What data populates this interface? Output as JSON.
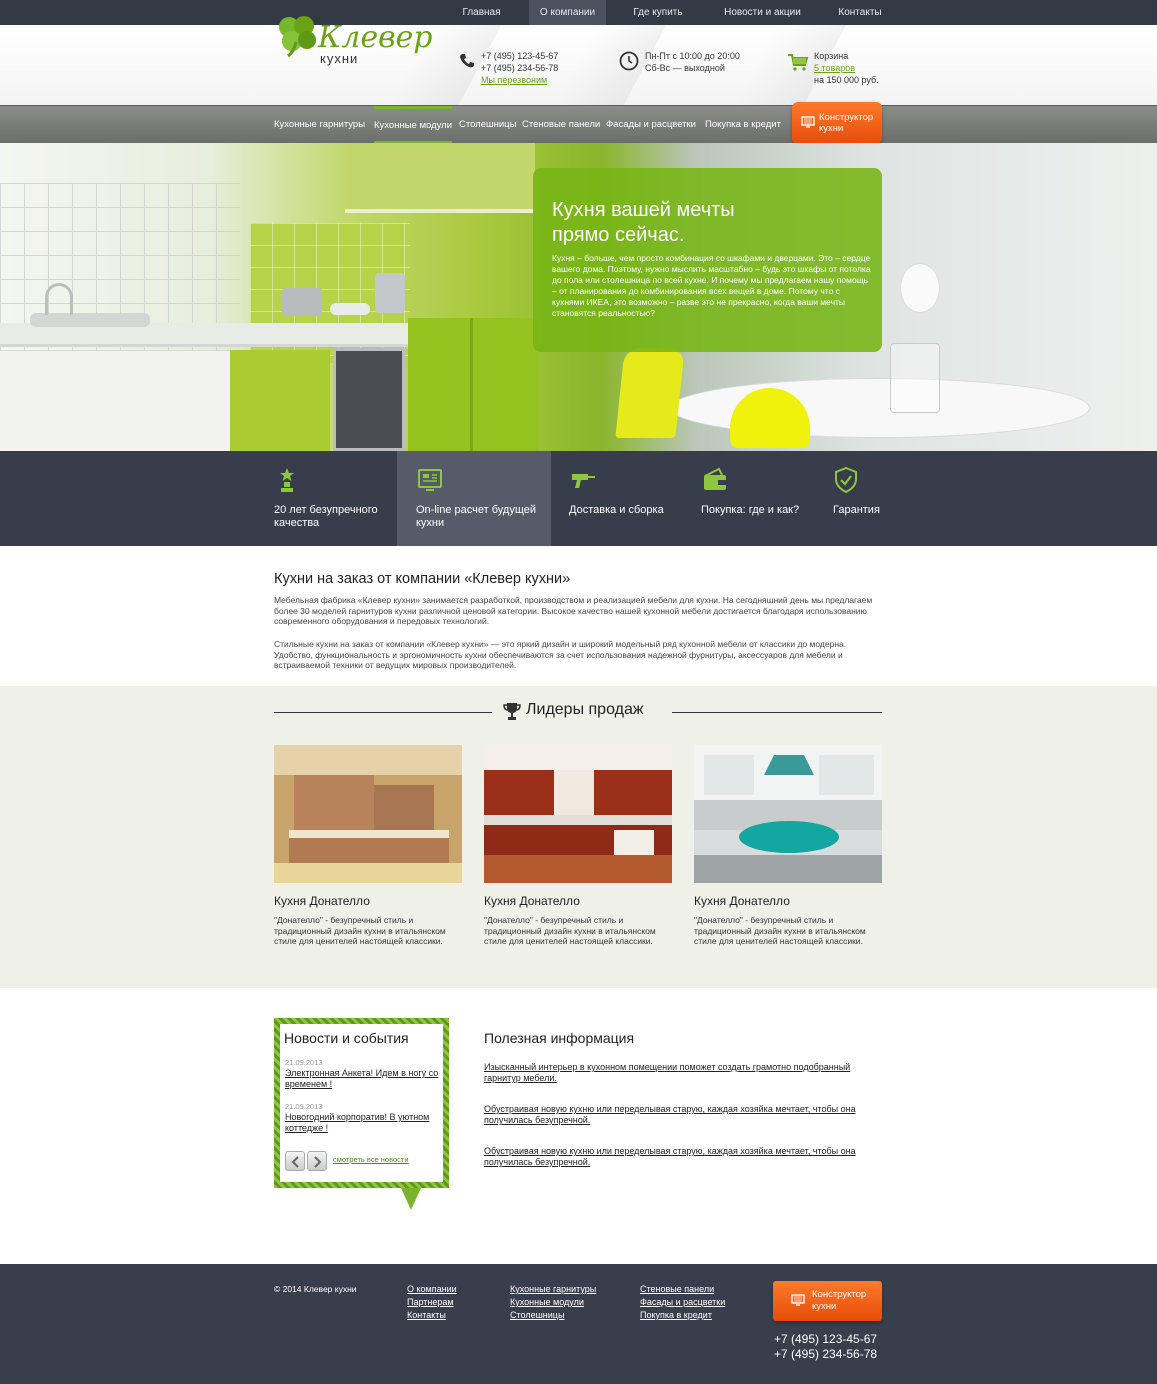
{
  "topnav": {
    "items": [
      {
        "label": "Главная"
      },
      {
        "label": "О компании"
      },
      {
        "label": "Где купить"
      },
      {
        "label": "Новости и акции"
      },
      {
        "label": "Контакты"
      }
    ],
    "active_index": 1
  },
  "header": {
    "logo_text": "Клевер",
    "logo_sub": "кухни",
    "phone1": "+7 (495) 123-45-67",
    "phone2": "+7 (495) 234-56-78",
    "callback_link": "Мы перезвоним",
    "hours1": "Пн-Пт с 10:00 до 20:00",
    "hours2": "Сб-Вс — выходной",
    "cart_label": "Корзина",
    "cart_items": "5 товаров",
    "cart_total": "на 150 000 руб.",
    "icons": {
      "phone": "phone-icon",
      "clock": "clock-icon",
      "cart": "cart-icon"
    }
  },
  "mainnav": {
    "items": [
      {
        "label": "Кухонные гарнитуры"
      },
      {
        "label": "Кухонные модули"
      },
      {
        "label": "Столешницы"
      },
      {
        "label": "Стеновые панели"
      },
      {
        "label": "Фасады и расцветки"
      },
      {
        "label": "Покупка в кредит"
      }
    ],
    "active_index": 1,
    "constructor_line1": "Конструктор",
    "constructor_line2": "кухни"
  },
  "hero": {
    "title_line1": "Кухня вашей мечты",
    "title_line2": "прямо сейчас.",
    "text": "Кухня – больше, чем просто комбинация со шкафами и дверцами. Это – сердце вашего дома. Поэтому, нужно мыслить масштабно – будь это шкафы от потолка до пола или столешница по всей кухне. И почему мы предлагаем нашу помощь – от планирования до комбинирования всех вещей в доме. Потому что с кухнями ИКЕА, это возможно – разве это не прекрасно, когда ваши мечты становятся реальностью?"
  },
  "features": [
    {
      "line1": "20 лет безупречного",
      "line2": "качества",
      "icon": "trophy-icon"
    },
    {
      "line1": "On-line расчет будущей",
      "line2": "кухни",
      "icon": "calculator-icon"
    },
    {
      "line1": "Доставка и сборка",
      "line2": "",
      "icon": "drill-icon"
    },
    {
      "line1": "Покупка: где и как?",
      "line2": "",
      "icon": "wallet-icon"
    },
    {
      "line1": "Гарантия",
      "line2": "",
      "icon": "shield-check-icon"
    }
  ],
  "intro": {
    "title": "Кухни на заказ от компании «Клевер кухни»",
    "p1": "Мебельная фабрика «Клевер кухни» занимается разработкой, производством и реализацией мебели для кухни. На сегодняшний день мы предлагаем более 30 моделей гарнитуров кухни различной ценовой категории. Высокое качество нашей кухонной мебели достигается благодаря использованию современного оборудования и передовых технологий.",
    "p2": "Стильные кухни на заказ от компании «Клевер кухни» — это яркий дизайн и широкий модельный ряд кухонной мебели от классики до модерна. Удобство, функциональность и эргономичность кухни обеспечиваются за счет использования надежной фурнитуры, аксессуаров для мебели и встраиваемой техники от ведущих мировых производителей."
  },
  "leaders": {
    "title": "Лидеры продаж",
    "products": [
      {
        "name": "Кухня Донателло",
        "desc": "\"Донателло\"  - безупречный стиль и традиционный дизайн кухни в итальянском стиле для ценителей настоящей классики."
      },
      {
        "name": "Кухня Донателло",
        "desc": "\"Донателло\"  - безупречный стиль и традиционный дизайн кухни в итальянском стиле для ценителей настоящей классики."
      },
      {
        "name": "Кухня Донателло",
        "desc": "\"Донателло\"  - безупречный стиль и традиционный дизайн кухни в итальянском стиле для ценителей настоящей классики."
      }
    ]
  },
  "news": {
    "title": "Новости и события",
    "items": [
      {
        "date": "21.09.2013",
        "text": "Электронная Анкета! Идем в ногу со временем !"
      },
      {
        "date": "21.09.2013",
        "text": "Новогодний корпоратив! В уютном коттедже !"
      }
    ],
    "all_link": "смотреть все новости"
  },
  "info": {
    "title": "Полезная информация",
    "links": [
      "Изысканный интерьер в кухонном помещении поможет создать грамотно подобранный гарнитур мебели.",
      "Обустраивая новую кухню или переделывая старую, каждая хозяйка мечтает, чтобы она получилась безупречной.",
      "Обустраивая новую кухню или переделывая старую, каждая хозяйка мечтает, чтобы она получилась безупречной."
    ]
  },
  "footer": {
    "copyright": "© 2014 Клевер кухни",
    "col1": [
      "О компании",
      "Партнерам",
      "Контакты"
    ],
    "col2": [
      "Кухонные гарнитуры",
      "Кухонные модули",
      "Столешницы"
    ],
    "col3": [
      "Стеновые панели",
      "Фасады и расцветки",
      "Покупка в кредит"
    ],
    "constructor_line1": "Конструктор",
    "constructor_line2": "кухни",
    "phone1": "+7 (495) 123-45-67",
    "phone2": "+7 (495) 234-56-78"
  },
  "colors": {
    "accent": "#7ab52b",
    "dark": "#383d4b",
    "orange": "#f06010"
  }
}
